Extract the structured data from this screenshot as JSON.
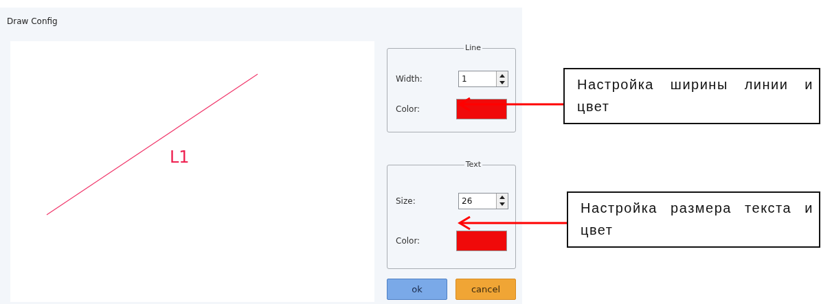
{
  "window": {
    "title": "Draw Config"
  },
  "canvas": {
    "label": "L1"
  },
  "groups": [
    {
      "title": "Line",
      "fields": [
        {
          "kind": "spin",
          "label": "Width:",
          "value": "1"
        },
        {
          "kind": "color",
          "label": "Color:",
          "color": "#f00a0a"
        }
      ]
    },
    {
      "title": "Text",
      "fields": [
        {
          "kind": "spin",
          "label": "Size:",
          "value": "26"
        },
        {
          "kind": "color",
          "label": "Color:",
          "color": "#f00a0a"
        }
      ]
    }
  ],
  "buttons": [
    {
      "label": "ok",
      "kind": "primary"
    },
    {
      "label": "cancel",
      "kind": "secondary"
    }
  ],
  "callouts": [
    {
      "text": "Настройка ширины линии и цвет"
    },
    {
      "text": "Настройка размера текста и цвет"
    }
  ]
}
